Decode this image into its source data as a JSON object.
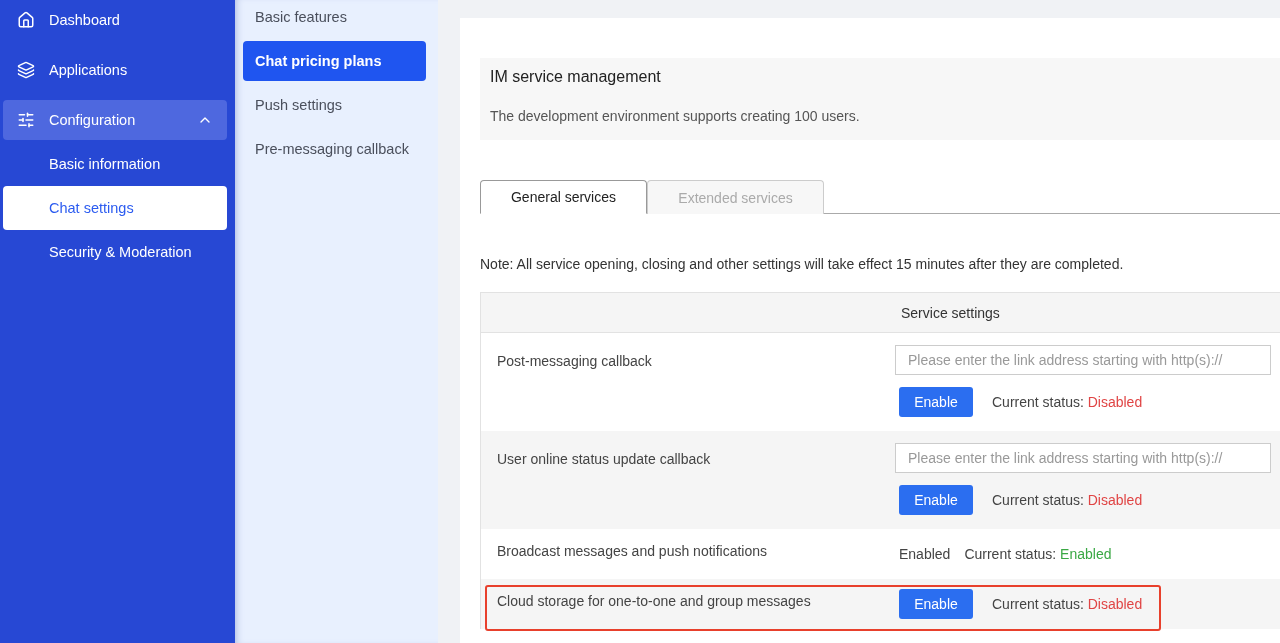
{
  "sidebar": {
    "items": [
      {
        "label": "Dashboard",
        "selected": false
      },
      {
        "label": "Applications",
        "selected": false
      },
      {
        "label": "Configuration",
        "selected": false,
        "expanded": true,
        "children": [
          {
            "label": "Basic information",
            "selected": false
          },
          {
            "label": "Chat settings",
            "selected": true
          },
          {
            "label": "Security & Moderation",
            "selected": false
          }
        ]
      }
    ]
  },
  "subnav": {
    "items": [
      {
        "label": "Basic features",
        "selected": false
      },
      {
        "label": "Chat pricing plans",
        "selected": true
      },
      {
        "label": "Push settings",
        "selected": false
      },
      {
        "label": "Pre-messaging callback",
        "selected": false
      }
    ]
  },
  "header": {
    "title": "IM service management",
    "description": "The development environment supports creating 100 users."
  },
  "tabs": [
    {
      "label": "General services",
      "selected": true
    },
    {
      "label": "Extended services",
      "selected": false
    }
  ],
  "note": "Note: All service opening, closing and other settings will take effect 15 minutes after they are completed.",
  "table": {
    "column_header": "Service settings",
    "rows": [
      {
        "kind": "callback",
        "name": "Post-messaging callback",
        "placeholder": "Please enter the link address starting with http(s)://",
        "button": "Enable",
        "status_label": "Current status:",
        "status": "Disabled",
        "enabled": false,
        "highlighted": false
      },
      {
        "kind": "callback",
        "name": "User online status update callback",
        "placeholder": "Please enter the link address starting with http(s)://",
        "button": "Enable",
        "status_label": "Current status:",
        "status": "Disabled",
        "enabled": false,
        "highlighted": false
      },
      {
        "kind": "static",
        "name": "Broadcast messages and push notifications",
        "value": "Enabled",
        "status_label": "Current status:",
        "status": "Enabled",
        "enabled": true,
        "highlighted": false
      },
      {
        "kind": "button",
        "name": "Cloud storage for one-to-one and group messages",
        "button": "Enable",
        "status_label": "Current status:",
        "status": "Disabled",
        "enabled": false,
        "highlighted": true
      }
    ]
  }
}
